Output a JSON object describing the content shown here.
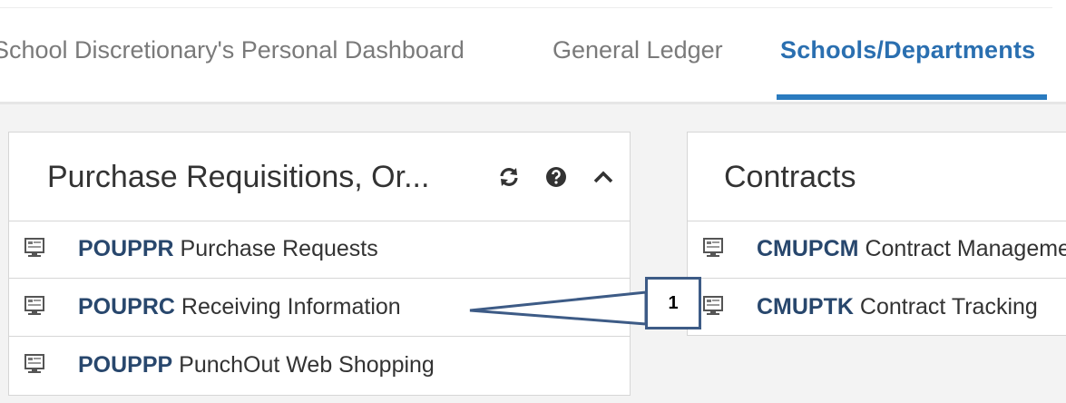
{
  "tabs": [
    {
      "label": "School Discretionary's Personal Dashboard",
      "active": false
    },
    {
      "label": "General Ledger",
      "active": false
    },
    {
      "label": "Schools/Departments",
      "active": true
    }
  ],
  "panels": {
    "left": {
      "title": "Purchase Requisitions, Or...",
      "icons": [
        "refresh-icon",
        "help-icon",
        "collapse-icon"
      ],
      "rows": [
        {
          "code": "POUPPR",
          "label": "Purchase Requests",
          "icon": "monitor-icon"
        },
        {
          "code": "POUPRC",
          "label": "Receiving Information",
          "icon": "monitor-icon"
        },
        {
          "code": "POUPPP",
          "label": "PunchOut Web Shopping",
          "icon": "monitor-icon"
        }
      ]
    },
    "right": {
      "title": "Contracts",
      "rows": [
        {
          "code": "CMUPCM",
          "label": "Contract Management",
          "icon": "monitor-icon"
        },
        {
          "code": "CMUPTK",
          "label": "Contract Tracking",
          "icon": "monitor-icon"
        }
      ]
    }
  },
  "callout": {
    "label": "1"
  },
  "colors": {
    "accent": "#2a7bbf",
    "code_text": "#28476d",
    "callout_border": "#3d5b86"
  }
}
